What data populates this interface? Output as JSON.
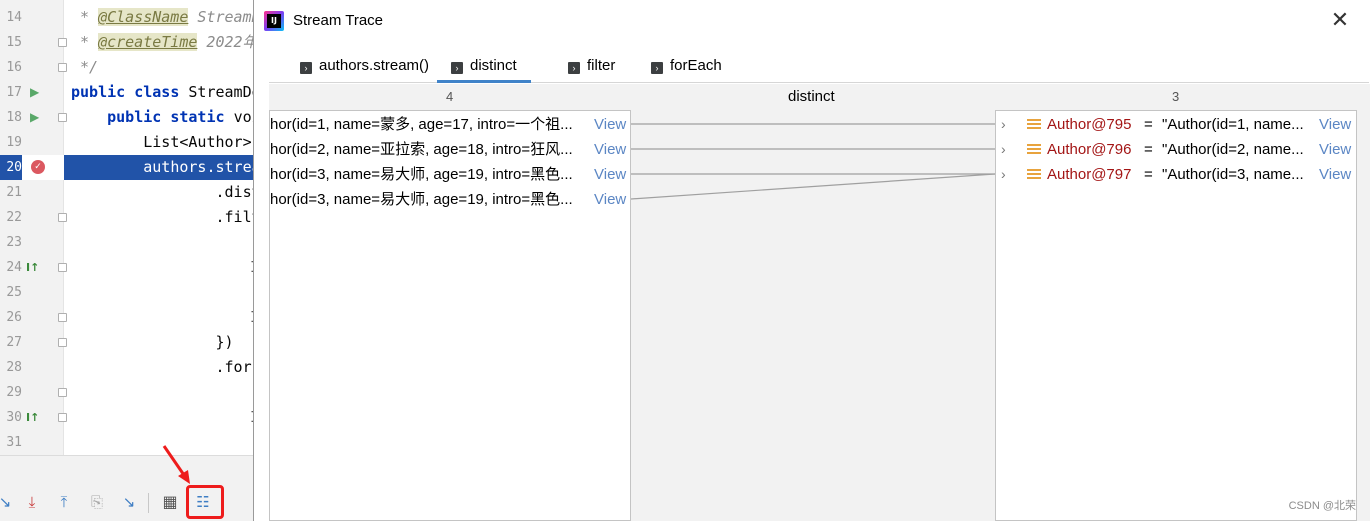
{
  "editor": {
    "lines": [
      {
        "num": "14",
        "text": "* @ClassName StreamD",
        "tag": "@ClassName",
        "kind": "comment"
      },
      {
        "num": "15",
        "text": "* @createTime 2022年",
        "tag": "@createTime",
        "kind": "comment"
      },
      {
        "num": "16",
        "text": "*/",
        "kind": "comment"
      },
      {
        "num": "17",
        "text": "public class StreamDe",
        "kind": "code"
      },
      {
        "num": "18",
        "text": "    public static voi",
        "kind": "code"
      },
      {
        "num": "19",
        "text": "        List<Author> ",
        "kind": "code"
      },
      {
        "num": "20",
        "text": "        authors.strea",
        "kind": "current"
      },
      {
        "num": "21",
        "text": "                .dist",
        "kind": "code"
      },
      {
        "num": "22",
        "text": "                .filt",
        "kind": "code"
      },
      {
        "num": "23",
        "text": "",
        "kind": "code"
      },
      {
        "num": "24",
        "text": "",
        "kind": "code"
      },
      {
        "num": "25",
        "text": "",
        "kind": "code"
      },
      {
        "num": "26",
        "text": "",
        "kind": "code"
      },
      {
        "num": "27",
        "text": "                })",
        "kind": "code"
      },
      {
        "num": "28",
        "text": "                .forE",
        "kind": "code"
      },
      {
        "num": "29",
        "text": "",
        "kind": "code"
      },
      {
        "num": "30",
        "text": "",
        "kind": "code"
      },
      {
        "num": "31",
        "text": "",
        "kind": "code"
      }
    ]
  },
  "dialog": {
    "title": "Stream Trace",
    "close_label": "✕",
    "tabs": [
      {
        "label": "authors.stream()",
        "selected": false
      },
      {
        "label": "distinct",
        "selected": true
      },
      {
        "label": "filter",
        "selected": false
      },
      {
        "label": "forEach",
        "selected": false
      }
    ],
    "operation": "distinct",
    "input_count": "4",
    "output_count": "3",
    "view_label": "View",
    "input_items": [
      "hor(id=1, name=蒙多, age=17, intro=一个祖...",
      "hor(id=2, name=亚拉索, age=18, intro=狂风...",
      "hor(id=3, name=易大师, age=19, intro=黑色...",
      "hor(id=3, name=易大师, age=19, intro=黑色..."
    ],
    "output_items": [
      {
        "ref": "Author@795",
        "value": "\"Author(id=1, name...",
        "view": "View"
      },
      {
        "ref": "Author@796",
        "value": "\"Author(id=2, name...",
        "view": "View"
      },
      {
        "ref": "Author@797",
        "value": "\"Author(id=3, name...",
        "view": "View"
      }
    ],
    "mappings": [
      [
        0,
        0
      ],
      [
        1,
        1
      ],
      [
        2,
        2
      ],
      [
        3,
        2
      ]
    ]
  },
  "watermark": "CSDN @北荣",
  "colors": {
    "accent": "#4083c9",
    "link": "#5b86c4",
    "selection": "#2153a8",
    "annotation": "#ee1c1c"
  }
}
